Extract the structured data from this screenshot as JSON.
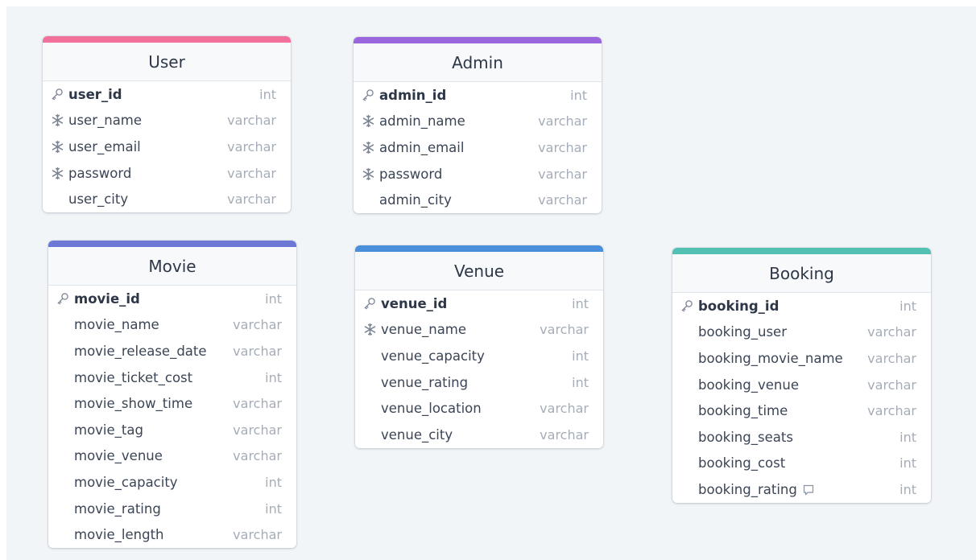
{
  "colors": {
    "user": "#f2719a",
    "admin": "#9966dd",
    "movie": "#6b78d6",
    "venue": "#4a8fdc",
    "booking": "#52c1b4"
  },
  "icons": {
    "primary_key": "key-icon",
    "unique": "snowflake-icon",
    "note": "note-icon"
  },
  "tables": [
    {
      "id": "user",
      "title": "User",
      "columns": [
        {
          "name": "user_id",
          "type": "int",
          "icon": "key"
        },
        {
          "name": "user_name",
          "type": "varchar",
          "icon": "snowflake"
        },
        {
          "name": "user_email",
          "type": "varchar",
          "icon": "snowflake"
        },
        {
          "name": "password",
          "type": "varchar",
          "icon": "snowflake"
        },
        {
          "name": "user_city",
          "type": "varchar",
          "icon": ""
        }
      ]
    },
    {
      "id": "admin",
      "title": "Admin",
      "columns": [
        {
          "name": "admin_id",
          "type": "int",
          "icon": "key"
        },
        {
          "name": "admin_name",
          "type": "varchar",
          "icon": "snowflake"
        },
        {
          "name": "admin_email",
          "type": "varchar",
          "icon": "snowflake"
        },
        {
          "name": "password",
          "type": "varchar",
          "icon": "snowflake"
        },
        {
          "name": "admin_city",
          "type": "varchar",
          "icon": ""
        }
      ]
    },
    {
      "id": "movie",
      "title": "Movie",
      "columns": [
        {
          "name": "movie_id",
          "type": "int",
          "icon": "key"
        },
        {
          "name": "movie_name",
          "type": "varchar",
          "icon": ""
        },
        {
          "name": "movie_release_date",
          "type": "varchar",
          "icon": ""
        },
        {
          "name": "movie_ticket_cost",
          "type": "int",
          "icon": ""
        },
        {
          "name": "movie_show_time",
          "type": "varchar",
          "icon": ""
        },
        {
          "name": "movie_tag",
          "type": "varchar",
          "icon": ""
        },
        {
          "name": "movie_venue",
          "type": "varchar",
          "icon": ""
        },
        {
          "name": "movie_capacity",
          "type": "int",
          "icon": ""
        },
        {
          "name": "movie_rating",
          "type": "int",
          "icon": ""
        },
        {
          "name": "movie_length",
          "type": "varchar",
          "icon": ""
        }
      ]
    },
    {
      "id": "venue",
      "title": "Venue",
      "columns": [
        {
          "name": "venue_id",
          "type": "int",
          "icon": "key"
        },
        {
          "name": "venue_name",
          "type": "varchar",
          "icon": "snowflake"
        },
        {
          "name": "venue_capacity",
          "type": "int",
          "icon": ""
        },
        {
          "name": "venue_rating",
          "type": "int",
          "icon": ""
        },
        {
          "name": "venue_location",
          "type": "varchar",
          "icon": ""
        },
        {
          "name": "venue_city",
          "type": "varchar",
          "icon": ""
        }
      ]
    },
    {
      "id": "booking",
      "title": "Booking",
      "columns": [
        {
          "name": "booking_id",
          "type": "int",
          "icon": "key"
        },
        {
          "name": "booking_user",
          "type": "varchar",
          "icon": ""
        },
        {
          "name": "booking_movie_name",
          "type": "varchar",
          "icon": ""
        },
        {
          "name": "booking_venue",
          "type": "varchar",
          "icon": ""
        },
        {
          "name": "booking_time",
          "type": "varchar",
          "icon": ""
        },
        {
          "name": "booking_seats",
          "type": "int",
          "icon": ""
        },
        {
          "name": "booking_cost",
          "type": "int",
          "icon": ""
        },
        {
          "name": "booking_rating",
          "type": "int",
          "icon": "",
          "note": true
        }
      ]
    }
  ]
}
